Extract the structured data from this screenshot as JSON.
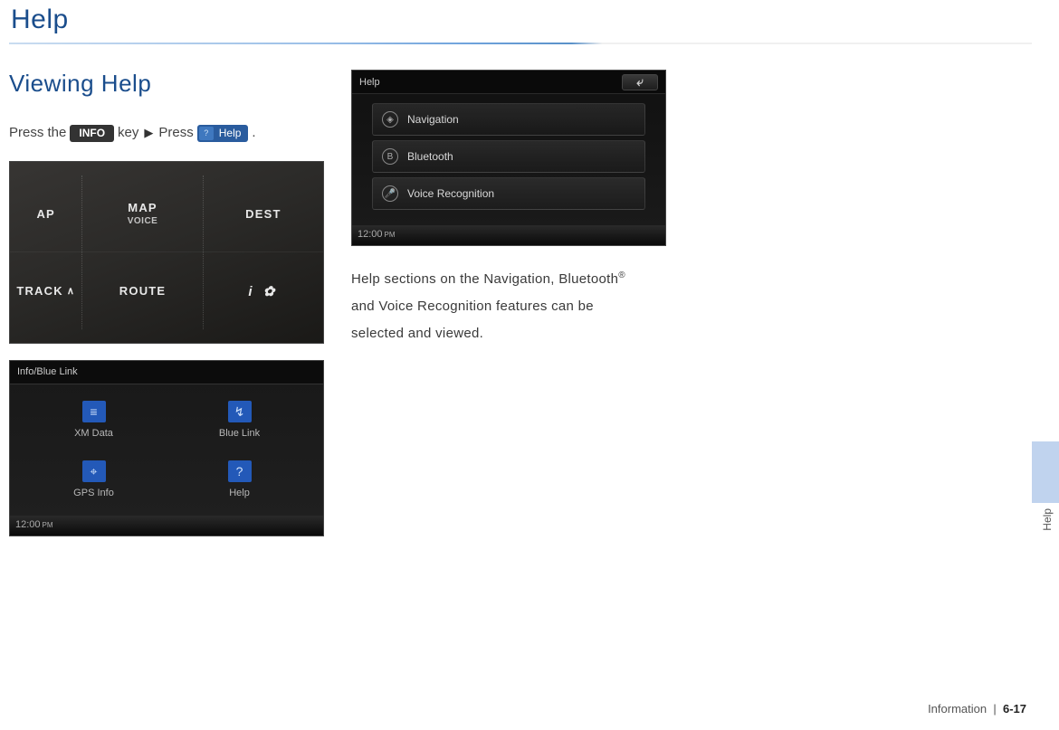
{
  "page": {
    "title": "Help",
    "section_title": "Viewing Help",
    "instruction": {
      "prefix": "Press the",
      "info_key": "INFO",
      "mid1": "key",
      "mid2": "Press",
      "help_label": "Help",
      "suffix": "."
    }
  },
  "hardware_panel": {
    "top_row": [
      "AP",
      "MAP\nVOICE",
      "DEST"
    ],
    "bottom_row": [
      "TRACK ^",
      "ROUTE",
      "i ⚙"
    ]
  },
  "info_screen": {
    "header": "Info/Blue Link",
    "tiles": [
      {
        "label": "XM Data",
        "icon": "≡"
      },
      {
        "label": "Blue Link",
        "icon": "↯"
      },
      {
        "label": "GPS Info",
        "icon": "⌖"
      },
      {
        "label": "Help",
        "icon": "?"
      }
    ],
    "clock": "12:00",
    "ampm": "PM"
  },
  "help_screen": {
    "header": "Help",
    "items": [
      {
        "label": "Navigation",
        "icon": "◈"
      },
      {
        "label": "Bluetooth",
        "icon": "B"
      },
      {
        "label": "Voice Recognition",
        "icon": "🎤"
      }
    ],
    "clock": "12:00",
    "ampm": "PM"
  },
  "body_text": {
    "l1a": "Help sections on the Navigation, Bluetooth",
    "sup": "®",
    "l2": "and Voice Recognition features can be",
    "l3": "selected and viewed."
  },
  "side_tab": "Help",
  "footer": {
    "section": "Information",
    "sep": "|",
    "page": "6-17"
  }
}
